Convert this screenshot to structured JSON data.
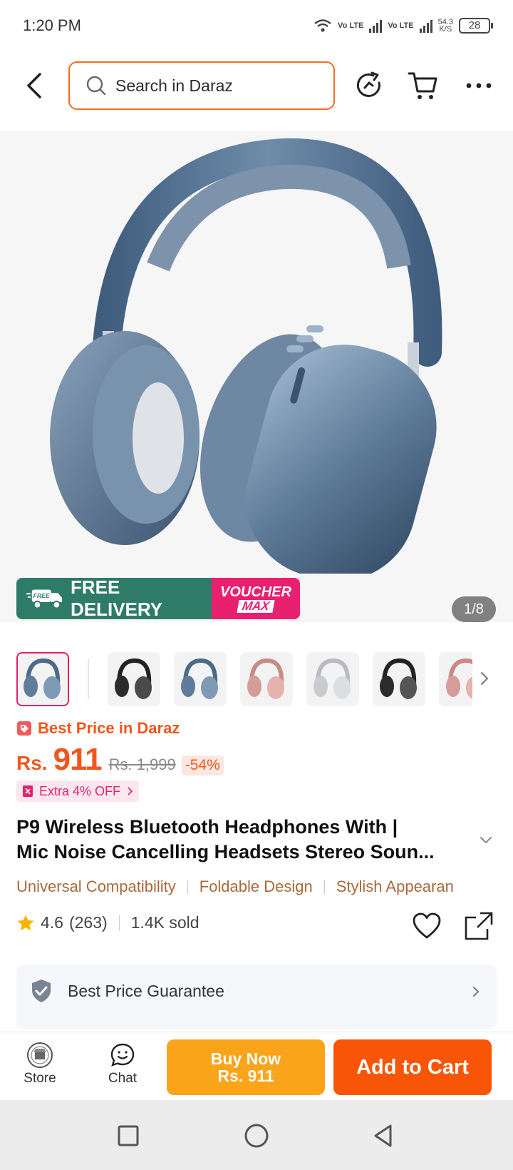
{
  "status_bar": {
    "time": "1:20 PM",
    "sim1": "Vo LTE",
    "sim2": "Vo LTE",
    "net_speed_value": "54.3",
    "net_speed_unit": "K/S",
    "battery": "28"
  },
  "header": {
    "search_placeholder": "Search in Daraz"
  },
  "gallery": {
    "promo_free_label": "FREE DELIVERY",
    "promo_truck_tag": "FREE",
    "promo_voucher_line1": "VOUCHER",
    "promo_voucher_line2": "MAX",
    "counter": "1/8",
    "thumbnail_colors": [
      "blue",
      "black",
      "blue",
      "pink",
      "silver",
      "black",
      "pink"
    ]
  },
  "pricing": {
    "badge": "Best Price in Daraz",
    "currency": "Rs.",
    "price": "911",
    "original_price": "Rs. 1,999",
    "discount": "-54%",
    "extra_offer": "Extra 4% OFF"
  },
  "product": {
    "title_line1": "P9 Wireless Bluetooth Headphones With |",
    "title_line2": "Mic Noise Cancelling Headsets Stereo Soun...",
    "features": [
      "Universal Compatibility",
      "Foldable Design",
      "Stylish Appearan"
    ],
    "rating": "4.6",
    "reviews": "(263)",
    "sold": "1.4K sold"
  },
  "guarantee": {
    "label": "Best Price Guarantee"
  },
  "action_bar": {
    "store_label": "Store",
    "chat_label": "Chat",
    "buy_now_line1": "Buy Now",
    "buy_now_line2": "Rs. 911",
    "add_to_cart": "Add to Cart"
  },
  "colors": {
    "brand_orange": "#f85606",
    "buy_now_yellow": "#faa41a",
    "promo_green": "#2e7b68",
    "promo_pink": "#e8206f"
  }
}
